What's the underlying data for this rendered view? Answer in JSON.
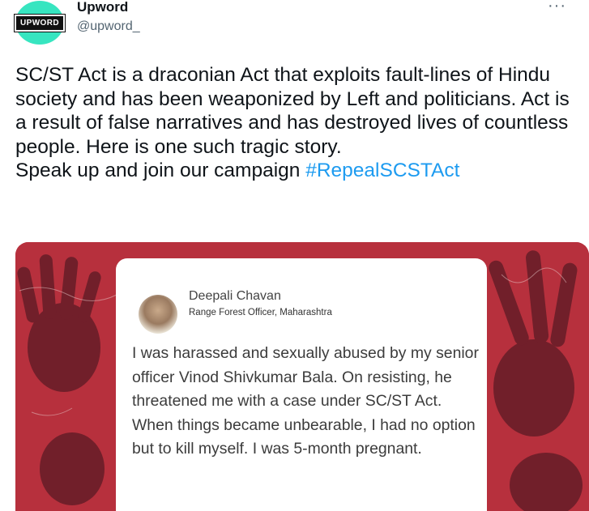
{
  "account": {
    "logo_text": "UPWORD",
    "display_name": "Upword",
    "handle": "@upword_",
    "more_label": "···",
    "avatar_color": "#37e5c0"
  },
  "tweet": {
    "text": "SC/ST Act is a draconian Act that exploits fault-lines of Hindu society and has been weaponized by Left and politicians. Act is a result of false narratives and has destroyed lives of countless people. Here is one such tragic story.",
    "cta": "Speak up and join our campaign ",
    "hashtag": "#RepealSCSTAct",
    "hashtag_color": "#1d9bf0"
  },
  "media": {
    "background_color": "#b7303d",
    "card": {
      "name": "Deepali Chavan",
      "role": "Range Forest Officer, Maharashtra",
      "quote": "I was harassed and sexually abused by my senior officer Vinod Shivkumar Bala. On resisting, he threatened me with a case under SC/ST Act. When things became unbearable, I had no option but to kill myself. I was 5-month pregnant."
    }
  }
}
